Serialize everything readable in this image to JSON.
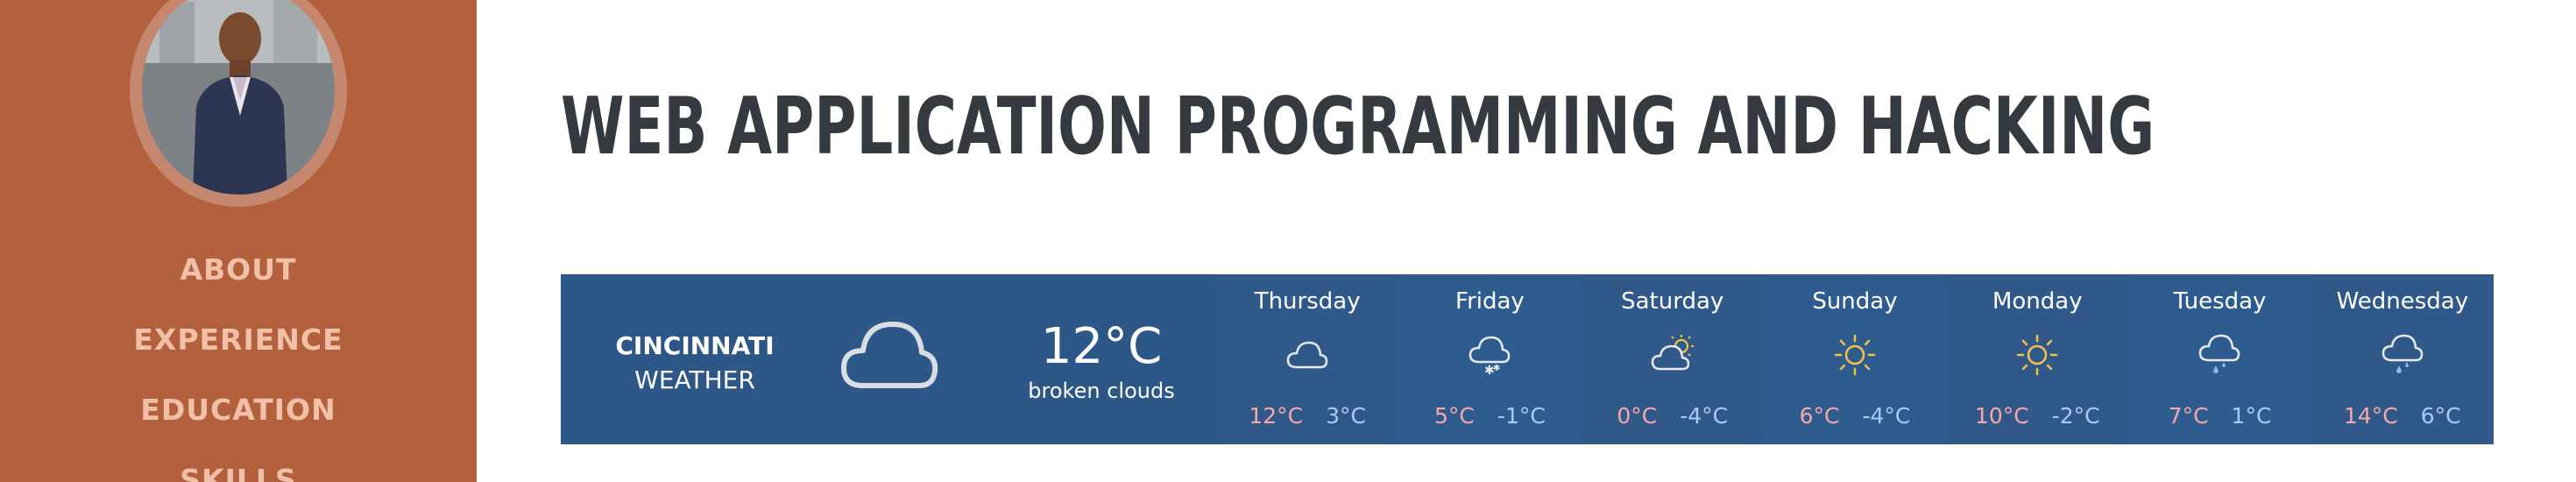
{
  "sidebar": {
    "nav": [
      "ABOUT",
      "EXPERIENCE",
      "EDUCATION",
      "SKILLS"
    ]
  },
  "main": {
    "title": "WEB APPLICATION PROGRAMMING AND HACKING"
  },
  "weather": {
    "city": "CINCINNATI",
    "label": "WEATHER",
    "current_icon": "cloud-icon",
    "temp": "12°C",
    "description": "broken clouds",
    "forecast": [
      {
        "day": "Thursday",
        "icon": "cloud-icon",
        "max": "12°C",
        "min": "3°C"
      },
      {
        "day": "Friday",
        "icon": "cloud-snow-icon",
        "max": "5°C",
        "min": "-1°C"
      },
      {
        "day": "Saturday",
        "icon": "cloud-sun-icon",
        "max": "0°C",
        "min": "-4°C"
      },
      {
        "day": "Sunday",
        "icon": "sun-icon",
        "max": "6°C",
        "min": "-4°C"
      },
      {
        "day": "Monday",
        "icon": "sun-icon",
        "max": "10°C",
        "min": "-2°C"
      },
      {
        "day": "Tuesday",
        "icon": "cloud-rain-icon",
        "max": "7°C",
        "min": "1°C"
      },
      {
        "day": "Wednesday",
        "icon": "cloud-rain-icon",
        "max": "14°C",
        "min": "6°C"
      }
    ],
    "colors": {
      "background": "#2c5786",
      "max_temp": "#f7a7a7",
      "min_temp": "#a9cbf7",
      "sun": "#f2c14e"
    }
  },
  "colors": {
    "sidebar": "#b3603c",
    "nav_text": "#f0c0a8",
    "title": "#343a40"
  }
}
